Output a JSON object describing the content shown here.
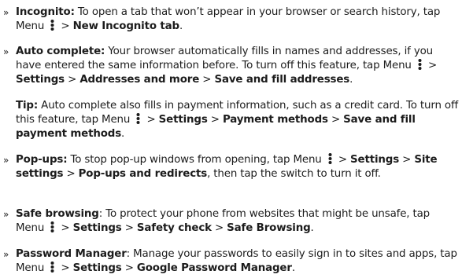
{
  "separator": " > ",
  "items": [
    {
      "heading": "Incognito:",
      "pre": " To open a tab that won’t appear in your browser or search history, tap Menu ",
      "path": [
        "New Incognito tab"
      ],
      "post": "."
    },
    {
      "heading": "Auto complete:",
      "pre": " Your browser automatically fills in names and addresses, if you have entered the same information before. To turn off this feature, tap Menu ",
      "path": [
        "Settings",
        "Addresses and more",
        "Save and fill addresses"
      ],
      "post": "."
    },
    {
      "heading": "Pop-ups:",
      "pre": " To stop pop-up windows from opening, tap Menu ",
      "path": [
        "Settings",
        "Site settings",
        "Pop-ups and redirects"
      ],
      "post": ", then tap the switch to turn it off."
    },
    {
      "heading": "Safe browsing",
      "pre": ": To protect your phone from websites that might be unsafe, tap Menu ",
      "path": [
        "Settings",
        "Safety check",
        "Safe Browsing"
      ],
      "post": "."
    },
    {
      "heading": "Password Manager",
      "pre": ": Manage your passwords to easily sign in to sites and apps, tap Menu ",
      "path": [
        "Settings",
        "Google Password Manager"
      ],
      "post": "."
    }
  ],
  "tip": {
    "heading": "Tip:",
    "pre": " Auto complete also fills in payment information, such as a credit card. To turn off this feature, tap Menu ",
    "path": [
      "Settings",
      "Payment methods",
      "Save and fill payment methods"
    ],
    "post": "."
  },
  "bullet_glyph": "»",
  "icon": "menu-vertical-dots-icon"
}
